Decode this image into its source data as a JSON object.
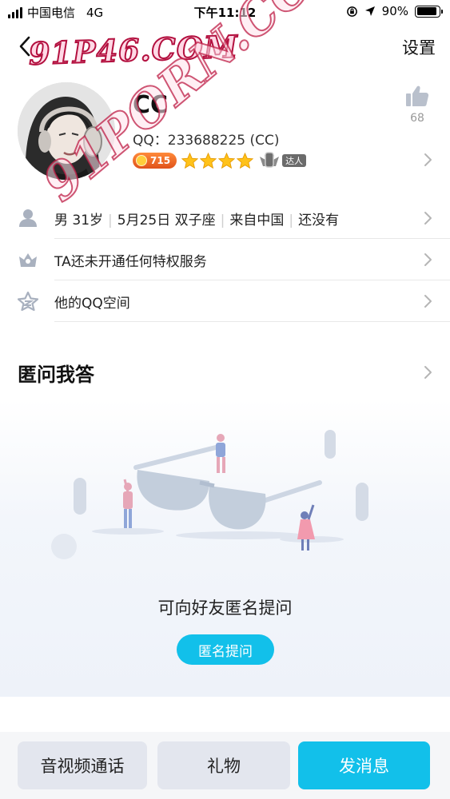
{
  "status_bar": {
    "carrier": "中国电信",
    "network": "4G",
    "time": "下午11:12",
    "battery": "90%",
    "battery_level": 0.9
  },
  "nav": {
    "settings_label": "设置",
    "watermark": "91P46.COM"
  },
  "watermark_diagonal": "91PORN.COM",
  "profile": {
    "nickname": "CC",
    "qq_line": "QQ：233688225 (CC)",
    "level_value": "715",
    "star_count": 4,
    "talent_label": "达人",
    "like_count": "68"
  },
  "info_rows": [
    {
      "parts": [
        "男 31岁",
        "5月25日 双子座",
        "来自中国",
        "还没有"
      ],
      "icon": "person-icon"
    },
    {
      "parts": [
        "TA还未开通任何特权服务"
      ],
      "icon": "privilege-icon"
    },
    {
      "parts": [
        "他的QQ空间"
      ],
      "icon": "qzone-star-icon"
    }
  ],
  "qa_section": {
    "title": "匿问我答",
    "empty_text": "可向好友匿名提问",
    "ask_button": "匿名提问"
  },
  "bottom_bar": {
    "call_label": "音视频通话",
    "gift_label": "礼物",
    "message_label": "发消息"
  },
  "colors": {
    "accent": "#12c0ea",
    "watermark_stroke": "#b3103f"
  }
}
